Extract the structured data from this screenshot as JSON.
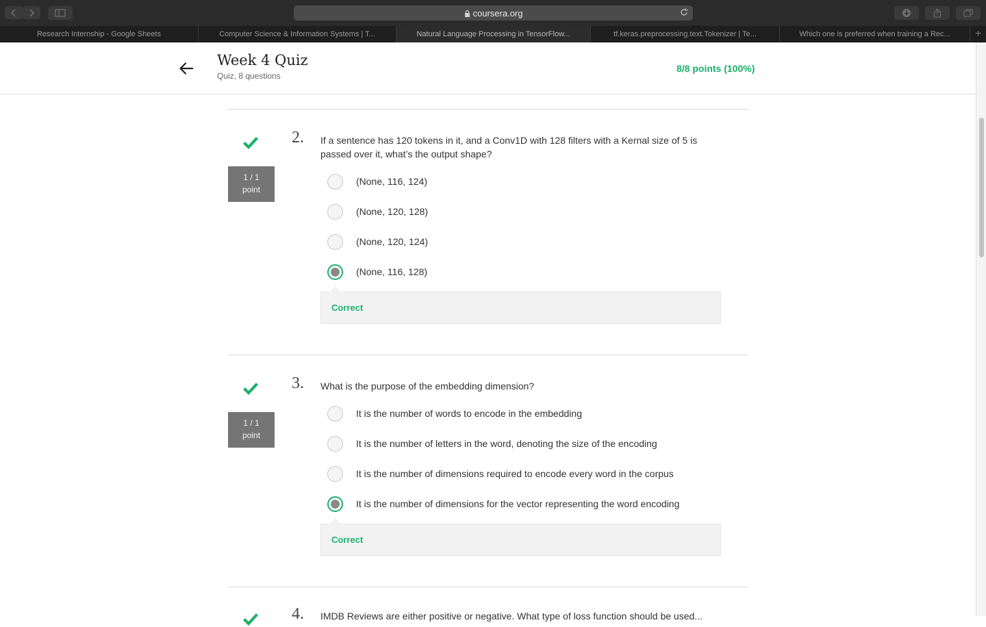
{
  "browser": {
    "address": "coursera.org",
    "tabs": [
      {
        "label": "Research Internship - Google Sheets"
      },
      {
        "label": "Computer Science & Information Systems | T..."
      },
      {
        "label": "Natural Language Processing in TensorFlow..."
      },
      {
        "label": "tf.keras.preprocessing.text.Tokenizer  |  Te..."
      },
      {
        "label": "Which one is preferred when training a Rec..."
      }
    ],
    "new_tab": "+"
  },
  "header": {
    "title": "Week 4 Quiz",
    "subtitle": "Quiz, 8 questions",
    "score": "8/8 points (100%)"
  },
  "questions": [
    {
      "number": "2.",
      "text": "If a sentence has 120 tokens in it, and a Conv1D with 128 filters with a Kernal size of 5 is passed over it, what’s the output shape?",
      "points_line1": "1 / 1",
      "points_line2": "point",
      "options": [
        {
          "label": "(None, 116, 124)",
          "selected": false
        },
        {
          "label": "(None, 120, 128)",
          "selected": false
        },
        {
          "label": "(None, 120, 124)",
          "selected": false
        },
        {
          "label": "(None, 116, 128)",
          "selected": true
        }
      ],
      "feedback": "Correct"
    },
    {
      "number": "3.",
      "text": "What is the purpose of the embedding dimension?",
      "points_line1": "1 / 1",
      "points_line2": "point",
      "options": [
        {
          "label": "It is the number of words to encode in the embedding",
          "selected": false
        },
        {
          "label": "It is the number of letters in the word, denoting the size of the encoding",
          "selected": false
        },
        {
          "label": "It is the number of dimensions required to encode every word in the corpus",
          "selected": false
        },
        {
          "label": "It is the number of dimensions for the vector representing the word encoding",
          "selected": true
        }
      ],
      "feedback": "Correct"
    }
  ],
  "next_question": {
    "number": "4.",
    "text_partial": "IMDB Reviews are either positive or negative. What type of loss function should be used..."
  },
  "colors": {
    "accent": "#1bb06b",
    "points_badge": "#757575"
  },
  "icons": [
    "back-arrow-icon",
    "check-icon",
    "lock-icon",
    "reload-icon"
  ]
}
